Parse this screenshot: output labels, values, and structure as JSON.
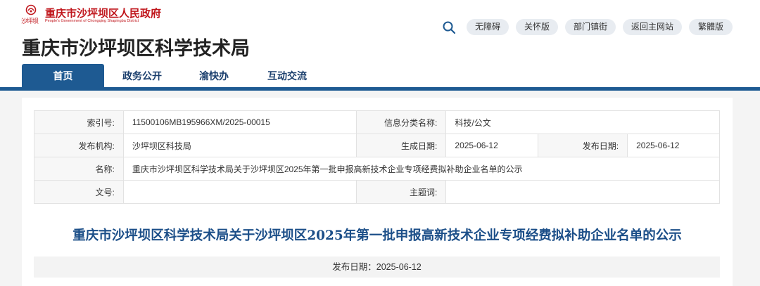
{
  "header": {
    "logo_sub": "沙坪坝",
    "logo_title": "重庆市沙坪坝区人民政府",
    "logo_en": "People's Government of Chongqing Shapingba District",
    "site_title": "重庆市沙坪坝区科学技术局",
    "top_links": [
      "无障碍",
      "关怀版",
      "部门镇街",
      "返回主网站",
      "繁體版"
    ],
    "brand_color": "#c0161c"
  },
  "nav": {
    "items": [
      "首页",
      "政务公开",
      "渝快办",
      "互动交流"
    ],
    "active_index": 0,
    "accent_color": "#1e5a92"
  },
  "meta": {
    "index_label": "索引号:",
    "index_value": "11500106MB195966XM/2025-00015",
    "category_label": "信息分类名称:",
    "category_value": "科技/公文",
    "publisher_label": "发布机构:",
    "publisher_value": "沙坪坝区科技局",
    "generated_label": "生成日期:",
    "generated_value": "2025-06-12",
    "published_label": "发布日期:",
    "published_value": "2025-06-12",
    "name_label": "名称:",
    "name_value": "重庆市沙坪坝区科学技术局关于沙坪坝区2025年第一批申报高新技术企业专项经费拟补助企业名单的公示",
    "docno_label": "文号:",
    "docno_value": "",
    "subject_label": "主题词:",
    "subject_value": ""
  },
  "article": {
    "title": "重庆市沙坪坝区科学技术局关于沙坪坝区2025年第一批申报高新技术企业专项经费拟补助企业名单的公示",
    "date_line": "发布日期：2025-06-12"
  }
}
